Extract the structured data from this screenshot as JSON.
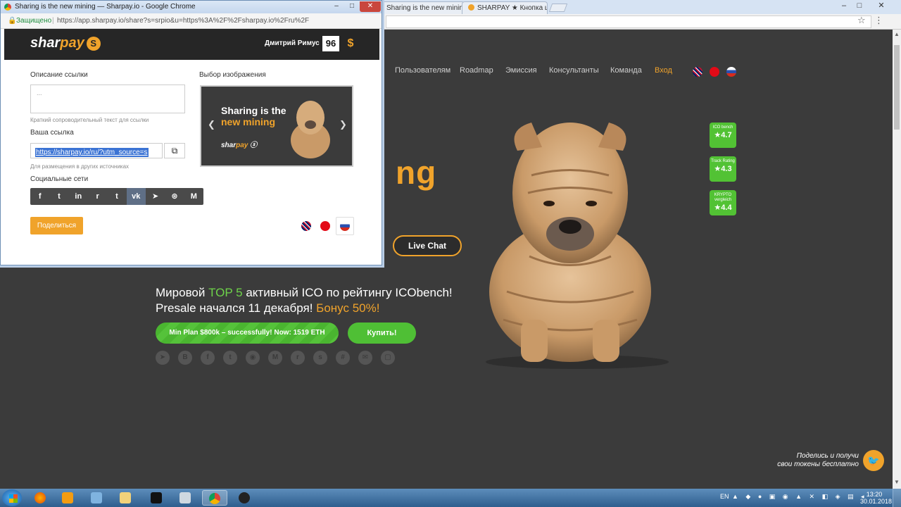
{
  "background_browser": {
    "tabs": [
      {
        "title": "Sharing is the new minin"
      },
      {
        "title": "SHARPAY ★ Кнопка ше"
      }
    ],
    "window_controls": [
      "–",
      "□",
      "✕"
    ],
    "site_nav": [
      "Пользователям",
      "Roadmap",
      "Эмиссия",
      "Консультанты",
      "Команда",
      "Вход"
    ],
    "hero_partial": "ng",
    "live_chat": "Live Chat",
    "promo": {
      "line1_prefix": "Мировой ",
      "line1_highlight": "TOP 5",
      "line1_suffix": " активный ICO по рейтингу ICObench!",
      "line2_prefix": "Presale начался 11 декабря! ",
      "line2_highlight": "Бонус 50%!"
    },
    "plan_button": "Min Plan $800k – successfully! Now: 1519 ETH",
    "buy_button": "Купить!",
    "ratings": [
      {
        "source": "ICO bench",
        "value": "★4.7"
      },
      {
        "source": "Track Rating",
        "value": "★4.3"
      },
      {
        "source": "KRYPTO vergleich",
        "value": "★4.4"
      }
    ],
    "footer_note_line1": "Поделись и получи",
    "footer_note_line2": "свои токены бесплатно"
  },
  "popup": {
    "window_title": "Sharing is the new mining — Sharpay.io - Google Chrome",
    "secure_label": "Защищено",
    "url": "https://app.sharpay.io/share?s=srpio&u=https%3A%2F%2Fsharpay.io%2Fru%2F",
    "logo_text_a": "shar",
    "logo_text_b": "pay",
    "user_name": "Дмитрий Римус",
    "user_balance": "96",
    "description_label": "Описание ссылки",
    "description_value": "...",
    "description_hint": "Краткий сопроводительный текст для ссылки",
    "link_label": "Ваша ссылка",
    "link_value": "https://sharpay.io/ru/?utm_source=s",
    "link_hint": "Для размещения в других источниках",
    "social_label": "Социальные сети",
    "social_buttons": [
      "f",
      "t",
      "in",
      "r",
      "t",
      "vk",
      "➤",
      "⊛",
      "M"
    ],
    "share_button": "Поделиться",
    "image_label": "Выбор изображения",
    "image_text1": "Sharing is the",
    "image_text2": "new mining",
    "image_logo_a": "shar",
    "image_logo_b": "pay"
  },
  "taskbar": {
    "lang": "EN",
    "time": "13:20",
    "date": "30.01.2018"
  }
}
